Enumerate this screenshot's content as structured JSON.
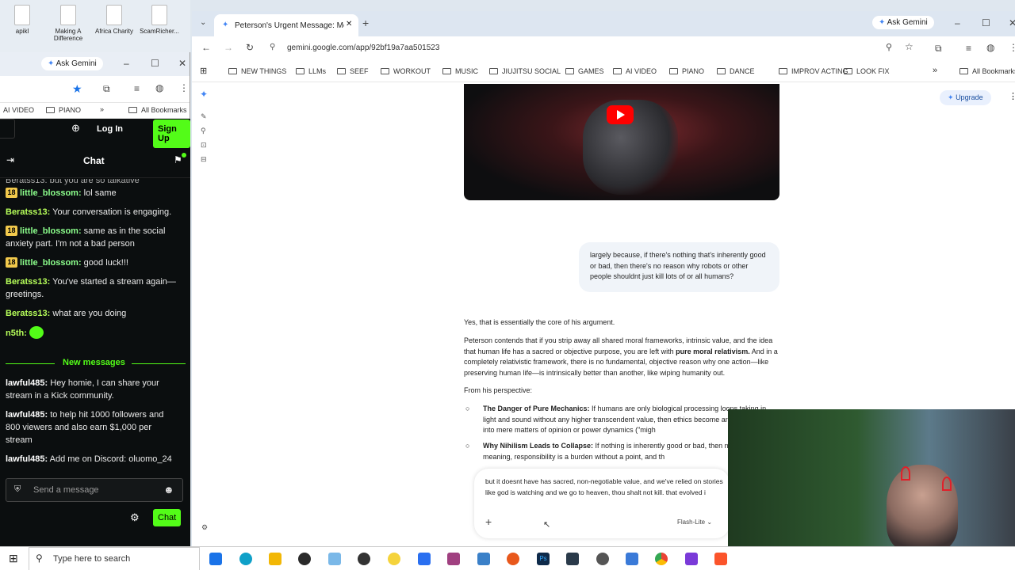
{
  "desktop": {
    "icons": [
      {
        "label": "apikl"
      },
      {
        "label": "Making A Difference"
      },
      {
        "label": "Africa Charity"
      },
      {
        "label": "ScamRicher..."
      }
    ]
  },
  "left_browser": {
    "ask_gemini": "Ask Gemini",
    "bookmarks": [
      "AI VIDEO",
      "PIANO",
      "All Bookmarks"
    ],
    "kick": {
      "login": "Log In",
      "signup": "Sign Up",
      "chat_title": "Chat",
      "truncated_top": "Beratss13: but you are so talkative",
      "messages": [
        {
          "badge": "18",
          "user": "little_blossom:",
          "text": " lol same",
          "user_color": "#8cff8c"
        },
        {
          "badge": "",
          "user": "Beratss13:",
          "text": " Your conversation is engaging.",
          "user_color": "#b7ff5a"
        },
        {
          "badge": "18",
          "user": "little_blossom:",
          "text": " same as in the social anxiety part. I'm not a bad person",
          "user_color": "#8cff8c"
        },
        {
          "badge": "18",
          "user": "little_blossom:",
          "text": " good luck!!!",
          "user_color": "#8cff8c"
        },
        {
          "badge": "",
          "user": "Beratss13:",
          "text": " You've started a stream again—greetings.",
          "user_color": "#b7ff5a"
        },
        {
          "badge": "",
          "user": "Beratss13:",
          "text": " what are you doing",
          "user_color": "#b7ff5a"
        },
        {
          "badge": "",
          "user": "n5th:",
          "text": "",
          "user_color": "#b7ff5a"
        }
      ],
      "new_messages": "New messages",
      "messages2": [
        {
          "user": "lawful485:",
          "text": " Hey homie, I can share your stream in a Kick community."
        },
        {
          "user": "lawful485:",
          "text": " to help hit 1000 followers and 800 viewers and also earn $1,000 per stream"
        },
        {
          "user": "lawful485:",
          "text": " Add me on Discord: oluomo_24"
        }
      ],
      "send_placeholder": "Send a message",
      "chat_button": "Chat"
    }
  },
  "right_browser": {
    "tab_title": "Peterson's Urgent Message: Me",
    "ask_gemini": "Ask Gemini",
    "url": "gemini.google.com/app/92bf19a7aa501523",
    "bookmarks": [
      "NEW THINGS",
      "LLMs",
      "SEEF",
      "WORKOUT",
      "MUSIC",
      "JIUJITSU SOCIAL",
      "GAMES",
      "AI VIDEO",
      "PIANO",
      "DANCE",
      "IMPROV ACTING",
      "LOOK FIX"
    ],
    "all_bookmarks": "All Bookmarks",
    "upgrade": "Upgrade",
    "user_message": "largely because, if there's nothing that's inherently good or bad, then there's no reason why robots or other people shouldnt just kill lots of or all humans?",
    "response": {
      "p1": "Yes, that is essentially the core of his argument.",
      "p2_a": "Peterson contends that if you strip away all shared moral frameworks, intrinsic value, and the idea that human life has a sacred or objective purpose, you are left with ",
      "p2_bold": "pure moral relativism.",
      "p2_b": " And in a completely relativistic framework, there is no fundamental, objective reason why one action—like preserving human life—is intrinsically better than another, like wiping humanity out.",
      "p3": "From his perspective:",
      "bullets": [
        {
          "title": "The Danger of Pure Mechanics:",
          "text": " If humans are only biological processing loops taking in light and sound without any higher transcendent value, then ethics become arbitrary. They turn into mere matters of opinion or power dynamics (\"migh"
        },
        {
          "title": "Why Nihilism Leads to Collapse:",
          "text": " If nothing is inherently good or bad, then no redemptive meaning, responsibility is a burden without a point, and th"
        }
      ]
    },
    "input_text": "but it doesnt have has sacred, non-negotiable value, and we've relied on stories like god is watching and we go to heaven, thou shalt not kill. that evolved i",
    "model": "Flash-Lite"
  },
  "taskbar": {
    "search_placeholder": "Type here to search"
  }
}
